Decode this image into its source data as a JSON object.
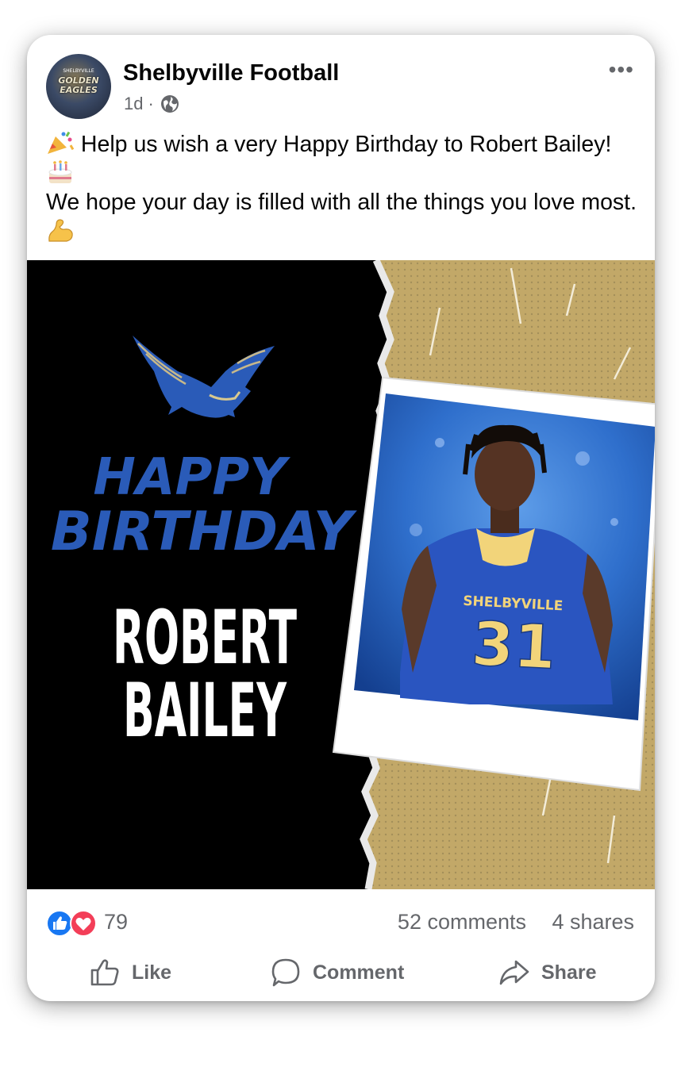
{
  "post": {
    "page_name": "Shelbyville Football",
    "avatar_text": "GOLDEN EAGLES",
    "avatar_subtext": "SHELBYVILLE",
    "time_ago": "1d",
    "separator": "·",
    "audience_icon": "globe-icon",
    "more_label": "•••",
    "caption_line1": "Help us wish a very Happy Birthday to Robert Bailey!",
    "caption_line2": "We hope your day is filled with all the things you love most.",
    "caption_emojis": [
      "party-popper-icon",
      "birthday-cake-icon",
      "flexed-biceps-icon"
    ]
  },
  "graphic": {
    "happy_text": "HAPPY",
    "birthday_text": "BIRTHDAY",
    "name_first": "ROBERT",
    "name_last": "BAILEY",
    "jersey_team": "SHELBYVILLE",
    "jersey_number": "31",
    "colors": {
      "black_panel": "#000000",
      "gold_panel": "#c2a868",
      "royal_blue": "#2a5bb8",
      "jersey_gold": "#f2d47a"
    }
  },
  "stats": {
    "reaction_icons": [
      "like-reaction-icon",
      "love-reaction-icon"
    ],
    "reaction_count": "79",
    "comments": "52 comments",
    "shares": "4 shares"
  },
  "actions": {
    "like": "Like",
    "comment": "Comment",
    "share": "Share"
  }
}
